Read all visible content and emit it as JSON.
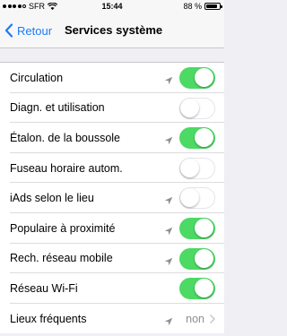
{
  "status_bar": {
    "carrier": "SFR",
    "time": "15:44",
    "battery_percent": "88 %",
    "battery_level": 0.88,
    "signal_bars": 4,
    "signal_max": 5
  },
  "nav": {
    "back_label": "Retour",
    "title": "Services système"
  },
  "accent_color": "#1a7cf5",
  "toggle_on_color": "#4cd964",
  "rows": [
    {
      "label": "Circulation",
      "location_icon": true,
      "toggle": true
    },
    {
      "label": "Diagn. et utilisation",
      "location_icon": false,
      "toggle": false
    },
    {
      "label": "Étalon. de la boussole",
      "location_icon": true,
      "toggle": true
    },
    {
      "label": "Fuseau horaire autom.",
      "location_icon": false,
      "toggle": false
    },
    {
      "label": "iAds selon le lieu",
      "location_icon": true,
      "toggle": false
    },
    {
      "label": "Populaire à proximité",
      "location_icon": true,
      "toggle": true
    },
    {
      "label": "Rech. réseau mobile",
      "location_icon": true,
      "toggle": true
    },
    {
      "label": "Réseau Wi-Fi",
      "location_icon": false,
      "toggle": true
    }
  ],
  "last_row": {
    "label": "Lieux fréquents",
    "value": "non",
    "location_icon": true
  }
}
